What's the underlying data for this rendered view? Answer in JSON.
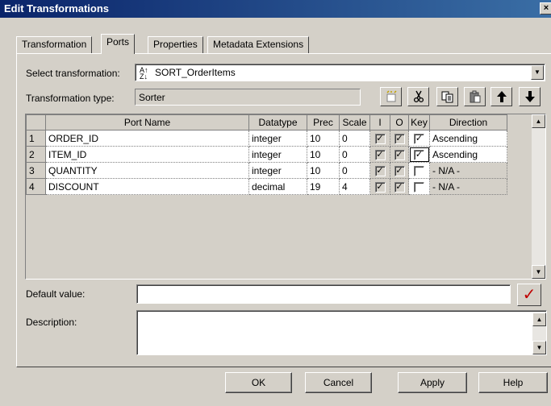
{
  "window": {
    "title": "Edit Transformations",
    "close_glyph": "×"
  },
  "tabs": [
    "Transformation",
    "Ports",
    "Properties",
    "Metadata Extensions"
  ],
  "active_tab": "Ports",
  "select_transformation": {
    "label": "Select transformation:",
    "value": "SORT_OrderItems",
    "icon": "sorter-icon"
  },
  "transformation_type": {
    "label": "Transformation type:",
    "value": "Sorter"
  },
  "toolbar_icons": [
    "new-port-icon",
    "cut-icon",
    "copy-icon",
    "paste-icon",
    "move-up-icon",
    "move-down-icon"
  ],
  "ports_table": {
    "columns": [
      "Port Name",
      "Datatype",
      "Prec",
      "Scale",
      "I",
      "O",
      "Key",
      "Direction"
    ],
    "rows": [
      {
        "num": "1",
        "name": "ORDER_ID",
        "datatype": "integer",
        "prec": "10",
        "scale": "0",
        "i": true,
        "o": true,
        "key": true,
        "direction": "Ascending"
      },
      {
        "num": "2",
        "name": "ITEM_ID",
        "datatype": "integer",
        "prec": "10",
        "scale": "0",
        "i": true,
        "o": true,
        "key": true,
        "direction": "Ascending"
      },
      {
        "num": "3",
        "name": "QUANTITY",
        "datatype": "integer",
        "prec": "10",
        "scale": "0",
        "i": true,
        "o": true,
        "key": false,
        "direction": "- N/A -"
      },
      {
        "num": "4",
        "name": "DISCOUNT",
        "datatype": "decimal",
        "prec": "19",
        "scale": "4",
        "i": true,
        "o": true,
        "key": false,
        "direction": "- N/A -"
      }
    ]
  },
  "default_value": {
    "label": "Default value:",
    "value": ""
  },
  "description": {
    "label": "Description:",
    "value": ""
  },
  "buttons": {
    "ok": "OK",
    "cancel": "Cancel",
    "apply": "Apply",
    "help": "Help"
  },
  "colors": {
    "title_start": "#0a246a",
    "title_end": "#3a6ea5",
    "face": "#d4d0c8",
    "validate_check": "#c00000"
  }
}
